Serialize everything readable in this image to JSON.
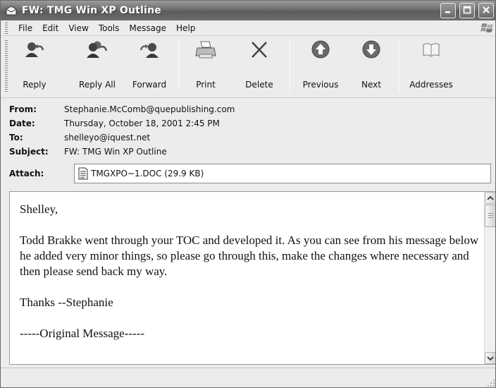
{
  "window": {
    "title": "FW: TMG Win XP Outline",
    "icon": "envelope-icon",
    "controls": [
      "minimize",
      "maximize",
      "close"
    ]
  },
  "menu": [
    "File",
    "Edit",
    "View",
    "Tools",
    "Message",
    "Help"
  ],
  "toolbar": {
    "buttons": [
      {
        "label": "Reply",
        "icon": "reply-icon"
      },
      {
        "label": "Reply All",
        "icon": "reply-all-icon"
      },
      {
        "label": "Forward",
        "icon": "forward-icon"
      },
      {
        "label": "Print",
        "icon": "printer-icon"
      },
      {
        "label": "Delete",
        "icon": "delete-x-icon"
      },
      {
        "label": "Previous",
        "icon": "up-arrow-icon"
      },
      {
        "label": "Next",
        "icon": "down-arrow-icon"
      },
      {
        "label": "Addresses",
        "icon": "address-book-icon"
      }
    ]
  },
  "header": {
    "from_label": "From:",
    "from": "Stephanie.McComb@quepublishing.com",
    "date_label": "Date:",
    "date": "Thursday, October 18, 2001 2:45 PM",
    "to_label": "To:",
    "to": "shelleyo@iquest.net",
    "subject_label": "Subject:",
    "subject": "FW: TMG Win XP Outline",
    "attach_label": "Attach:",
    "attachment": "TMGXPO~1.DOC (29.9 KB)"
  },
  "body": {
    "paragraphs": [
      "Shelley,",
      "Todd Brakke went through your TOC and developed it.  As you can see from his message below he added very minor things, so please go through this, make the changes where necessary and then please send back my way.",
      "Thanks --Stephanie",
      "-----Original Message-----"
    ]
  }
}
